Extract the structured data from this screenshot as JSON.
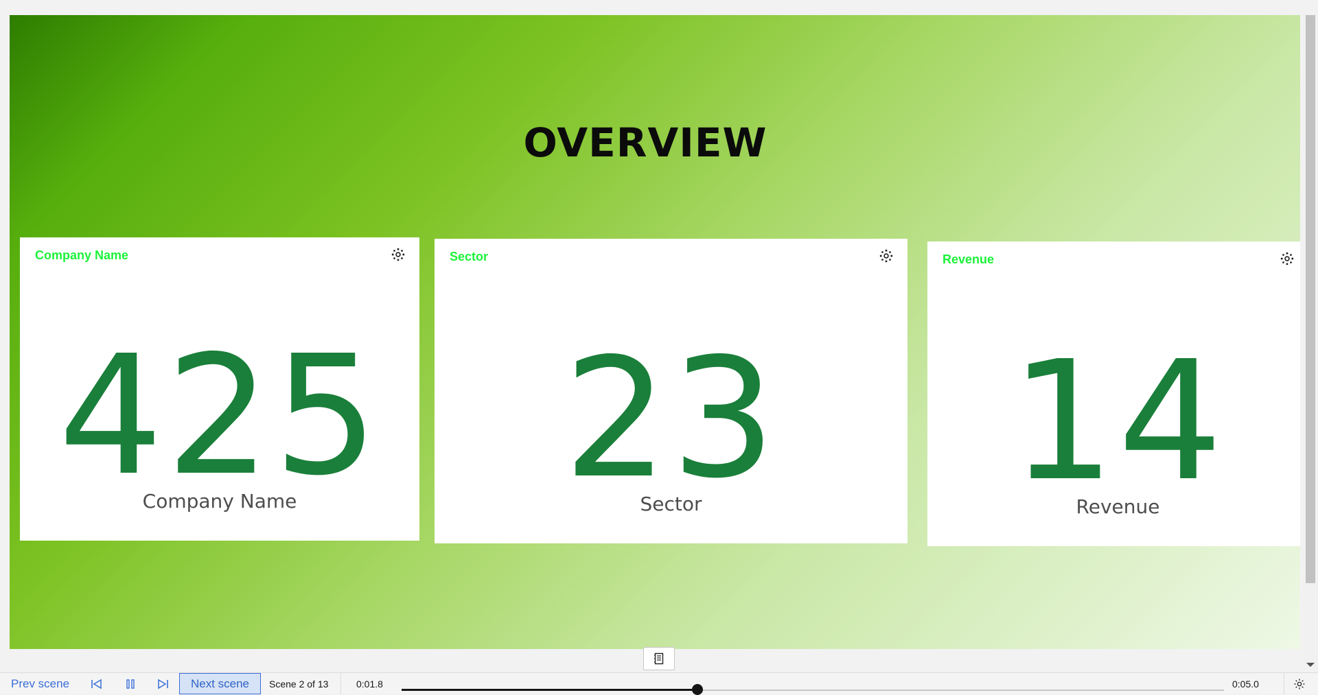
{
  "page": {
    "title": "OVERVIEW"
  },
  "cards": [
    {
      "title": "Company Name",
      "value": "425",
      "caption": "Company Name",
      "menu_icon": "gear-icon"
    },
    {
      "title": "Sector",
      "value": "23",
      "caption": "Sector",
      "menu_icon": "gear-icon"
    },
    {
      "title": "Revenue",
      "value": "14",
      "caption": "Revenue",
      "menu_icon": "gear-icon"
    }
  ],
  "colors": {
    "card_title": "#1cf23a",
    "kpi_value": "#1a7f3a",
    "accent": "#3a6fd8"
  },
  "playback": {
    "prev_label": "Prev scene",
    "next_label": "Next scene",
    "scene_counter": "Scene 2 of 13",
    "time_current": "0:01.8",
    "time_total": "0:05.0",
    "progress": 0.36,
    "icons": [
      "skip-back-icon",
      "pause-icon",
      "skip-forward-icon",
      "settings-icon",
      "notes-icon"
    ]
  }
}
